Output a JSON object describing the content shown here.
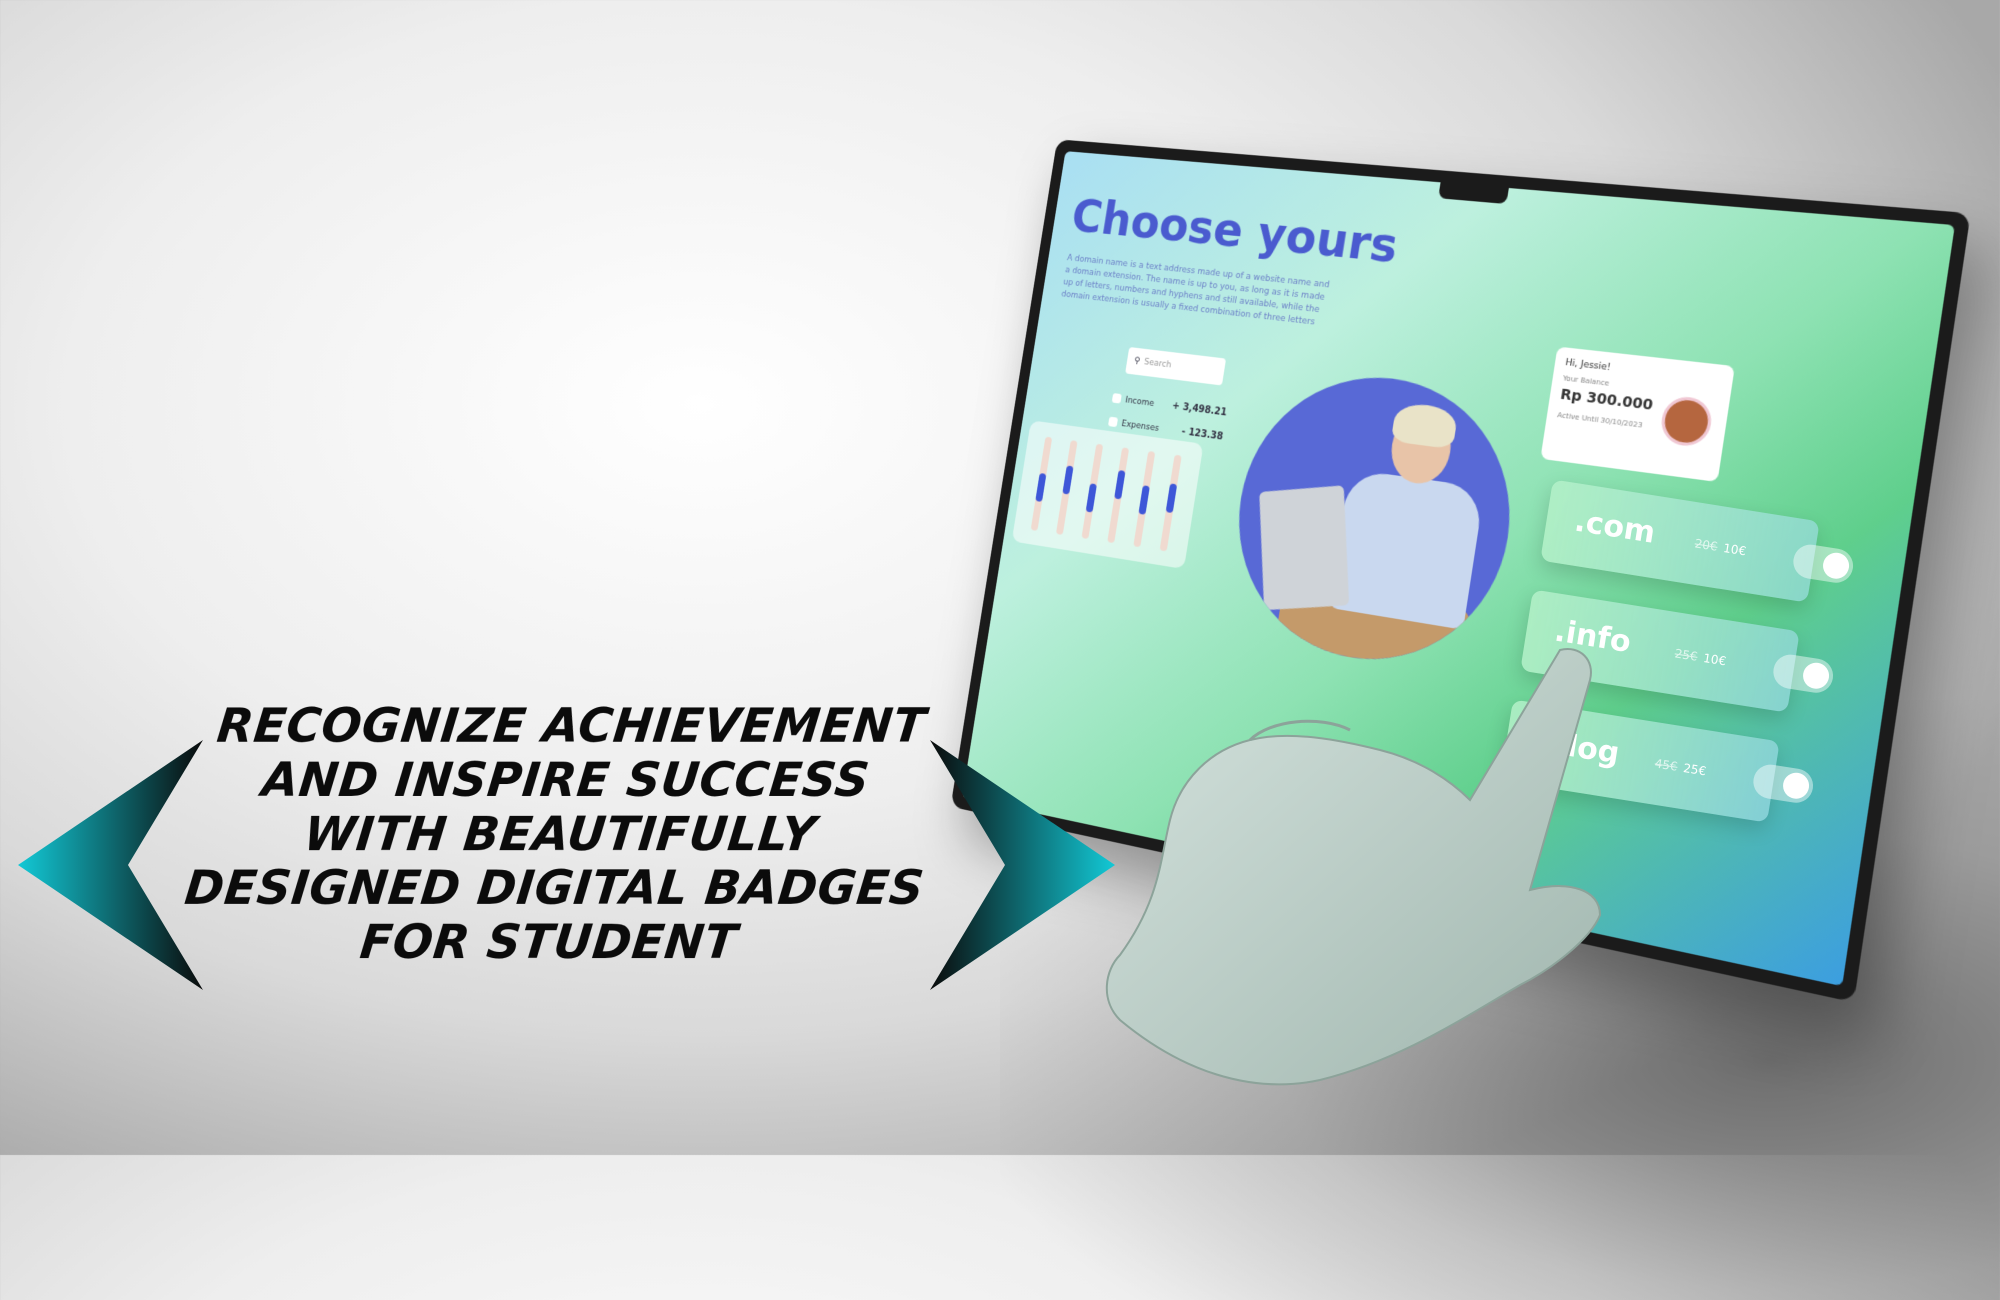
{
  "headline": {
    "lines": [
      "RECOGNIZE ACHIEVEMENT",
      "AND INSPIRE SUCCESS",
      "WITH BEAUTIFULLY",
      "DESIGNED DIGITAL BADGES",
      "FOR STUDENT"
    ]
  },
  "screen": {
    "title": "Choose yours",
    "description": "A domain name is a text address made up of a website name and a domain extension. The name is up to you, as long as it is made up of letters, numbers and hyphens and still available, while the domain extension is usually a fixed combination of three letters",
    "search_placeholder": "Search",
    "income_label": "Income",
    "income_value": "+ 3,498.21",
    "expenses_label": "Expenses",
    "expenses_value": "- 123.38",
    "bars": [
      0.35,
      0.55,
      0.3,
      0.6,
      0.4,
      0.5
    ],
    "balance": {
      "greeting": "Hi, Jessie!",
      "label": "Your Balance",
      "amount": "Rp 300.000",
      "active": "Active Until 30/10/2023"
    }
  },
  "domains": [
    {
      "name": ".com",
      "old_price": "20€",
      "price": "10€"
    },
    {
      "name": ".info",
      "old_price": "25€",
      "price": "10€"
    },
    {
      "name": ".blog",
      "old_price": "45€",
      "price": "25€"
    }
  ],
  "colors": {
    "accent_blue": "#4a5bcf",
    "chevron_teal": "#12c9d6",
    "text_dark": "#0b0b0b"
  }
}
